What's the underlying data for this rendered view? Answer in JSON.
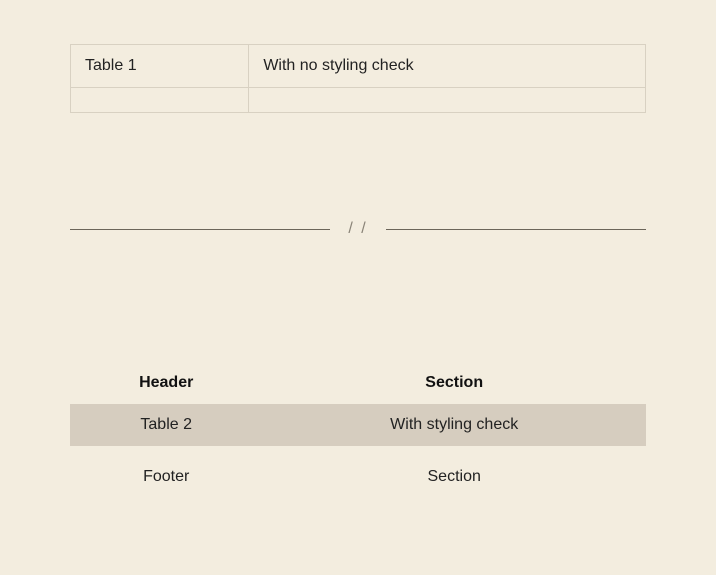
{
  "table1": {
    "row0": {
      "c0": "Table 1",
      "c1": "With no styling check"
    },
    "row1": {
      "c0": "",
      "c1": ""
    }
  },
  "divider": {
    "mark": "/  /"
  },
  "table2": {
    "head": {
      "c0": "Header",
      "c1": "Section"
    },
    "body": {
      "c0": "Table 2",
      "c1": "With styling check"
    },
    "foot": {
      "c0": "Footer",
      "c1": "Section"
    }
  }
}
